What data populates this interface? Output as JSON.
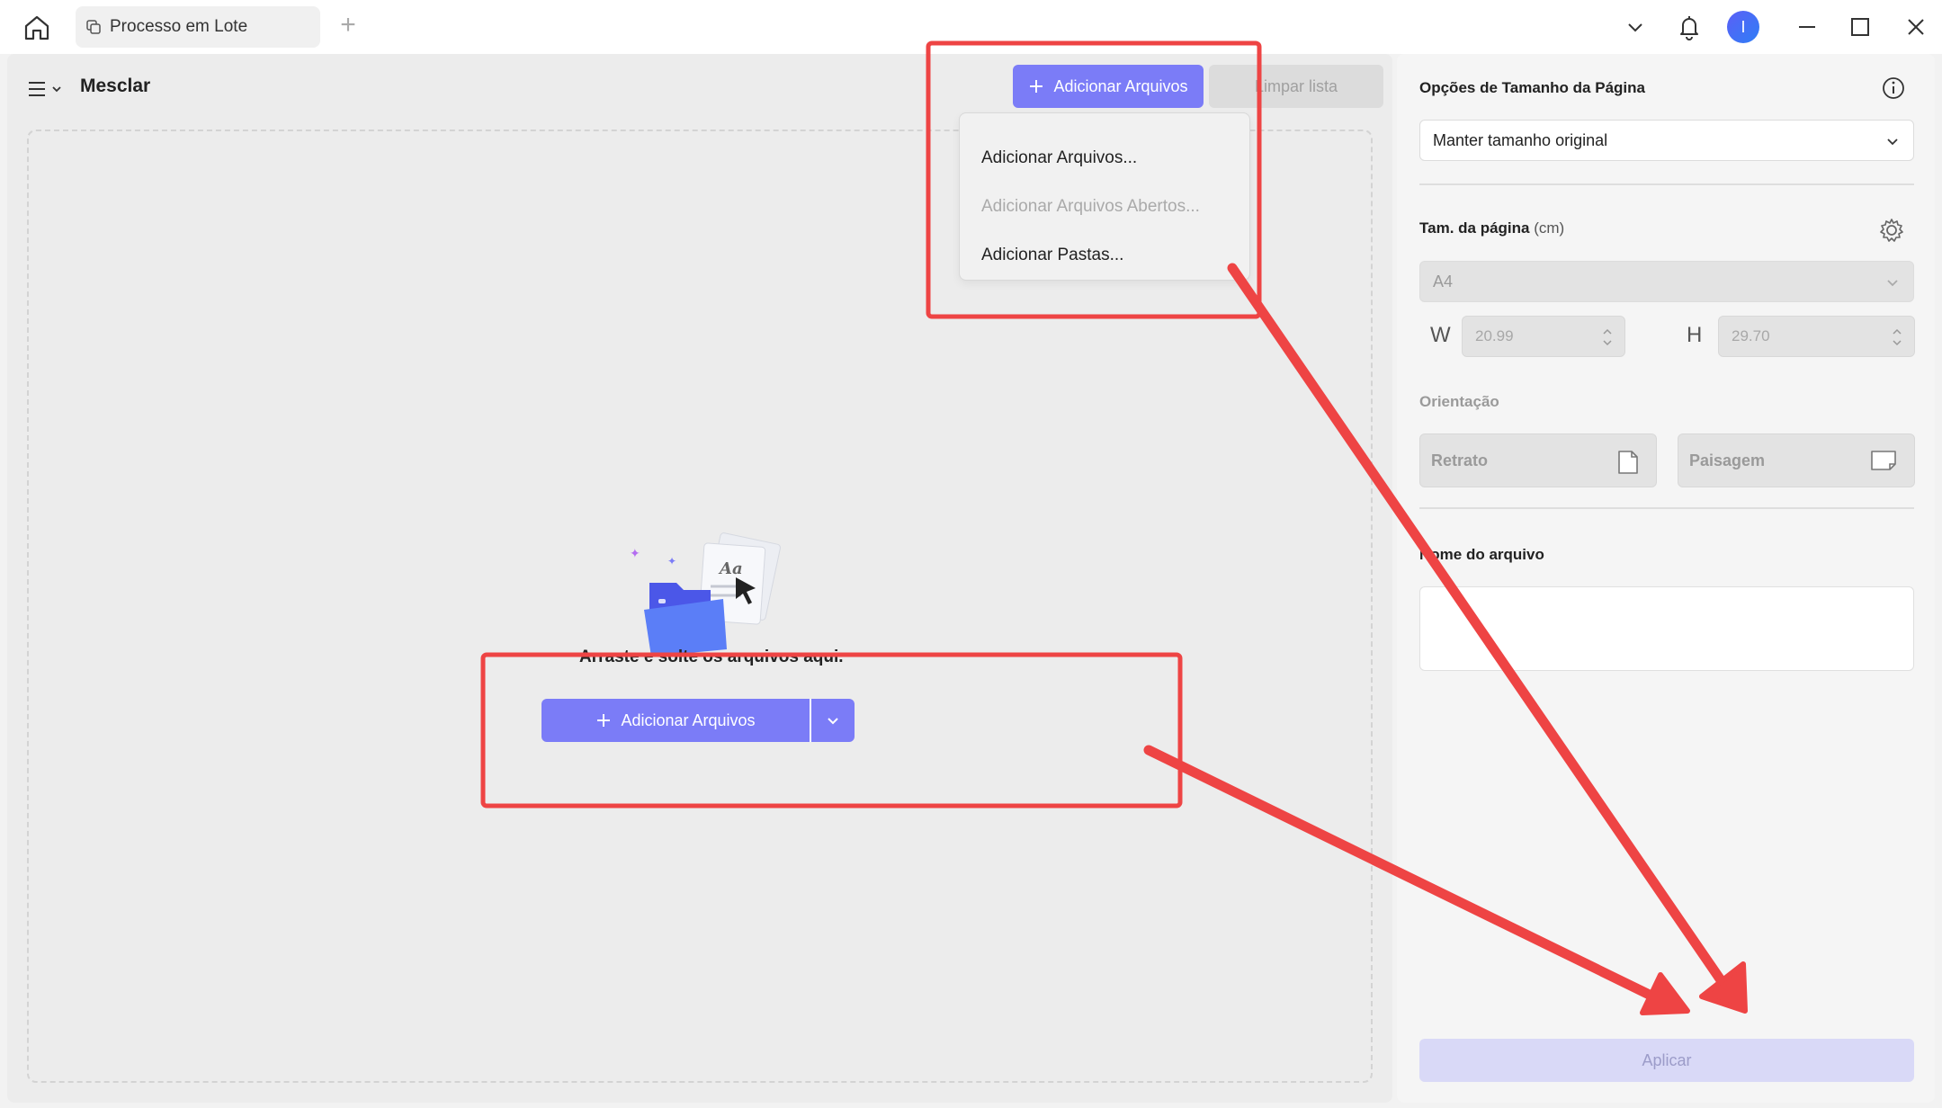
{
  "titlebar": {
    "tab_label": "Processo em Lote",
    "new_tab_symbol": "+",
    "avatar_initial": "I"
  },
  "main": {
    "title": "Mesclar",
    "add_files_label": "Adicionar Arquivos",
    "clear_list_label": "Limpar lista",
    "drop_text": "Arraste e solte os arquivos aqui.",
    "split_button_label": "Adicionar Arquivos"
  },
  "dropdown": {
    "items": [
      {
        "label": "Adicionar Arquivos...",
        "enabled": true
      },
      {
        "label": "Adicionar Arquivos Abertos...",
        "enabled": false
      },
      {
        "label": "Adicionar Pastas...",
        "enabled": true
      }
    ]
  },
  "right_panel": {
    "title": "Opções de Tamanho da Página",
    "size_option_value": "Manter tamanho original",
    "page_size_label": "Tam. da página",
    "page_size_unit": "(cm)",
    "page_size_value": "A4",
    "width_letter": "W",
    "width_value": "20.99",
    "height_letter": "H",
    "height_value": "29.70",
    "orientation_label": "Orientação",
    "portrait_label": "Retrato",
    "landscape_label": "Paisagem",
    "filename_label": "Nome do arquivo",
    "filename_value": "",
    "apply_label": "Aplicar"
  },
  "colors": {
    "accent": "#7b7cf7",
    "annotation": "#ee4444",
    "apply_disabled": "#d9d9f7"
  },
  "icons": {
    "home": "home-icon",
    "tab": "copy-icon",
    "notification": "bell-icon",
    "minimize": "minimize-icon",
    "maximize": "maximize-icon",
    "close": "close-icon",
    "info": "info-icon",
    "settings": "gear-icon"
  }
}
